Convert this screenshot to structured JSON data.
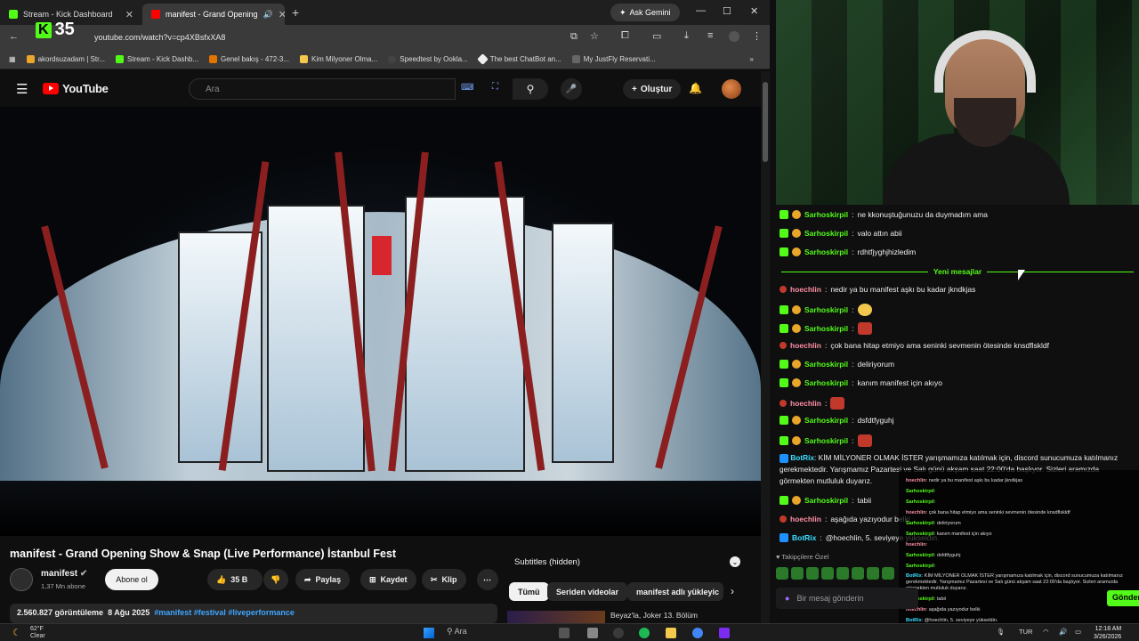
{
  "browser": {
    "tabs": [
      {
        "label": "Stream - Kick Dashboard",
        "active": false,
        "favicon_color": "#53fc18"
      },
      {
        "label": "manifest - Grand Opening",
        "active": true,
        "favicon_color": "#ff0000"
      }
    ],
    "new_tab_icon": "plus-icon",
    "gemini_label": "Ask Gemini",
    "url": "youtube.com/watch?v=cp4XBsfxXA8",
    "kick_badge_number": "35",
    "bookmarks": [
      "akordsuzadam | Str...",
      "Stream - Kick Dashb...",
      "Genel bakış - 472-3...",
      "Kim Milyoner Olma...",
      "Speedtest by Ookla...",
      "The best ChatBot an...",
      "My JustFly Reservati..."
    ]
  },
  "youtube": {
    "logo_text": "YouTube",
    "search_placeholder": "Ara",
    "create_label": "Oluştur",
    "video": {
      "title": "manifest - Grand Opening Show & Snap (Live Performance) İstanbul Fest",
      "channel": "manifest",
      "subscribers": "1,37 Mn abone",
      "subscribe_label": "Abone ol",
      "likes": "35 B",
      "share_label": "Paylaş",
      "save_label": "Kaydet",
      "clip_label": "Klip",
      "views": "2.560.827 görüntüleme",
      "date": "8 Ağu 2025",
      "hashtags": "#manifest #festival #liveperformance"
    },
    "sidebar": {
      "subtitles_label": "Subtitles (hidden)",
      "chips": [
        "Tümü",
        "Seriden videolar",
        "manifest adlı yükleyic"
      ],
      "next_title": "Beyaz'la, Joker 13. Bölüm"
    }
  },
  "kick": {
    "new_messages_label": "Yeni mesajlar",
    "messages": [
      {
        "user": "Sarhoskirpil",
        "text": "ne kkonuştuğunuzu da duymadım ama",
        "type": "sub"
      },
      {
        "user": "Sarhoskirpil",
        "text": "valo attın abii",
        "type": "sub"
      },
      {
        "user": "Sarhoskirpil",
        "text": "rdhtfjyghjhizledim",
        "type": "sub"
      },
      {
        "user": "hoechlin",
        "text": "nedir ya bu manifest aşkı bu kadar jkndkjas",
        "type": "viewer"
      },
      {
        "user": "Sarhoskirpil",
        "text": "",
        "type": "sub",
        "emote": "yellow"
      },
      {
        "user": "Sarhoskirpil",
        "text": "",
        "type": "sub",
        "emote": "red"
      },
      {
        "user": "hoechlin",
        "text": "çok bana hitap etmiyo ama seninki sevmenin ötesinde knsdflskldf",
        "type": "viewer"
      },
      {
        "user": "Sarhoskirpil",
        "text": "deliriyorum",
        "type": "sub"
      },
      {
        "user": "Sarhoskirpil",
        "text": "kanım manifest için akıyo",
        "type": "sub"
      },
      {
        "user": "hoechlin",
        "text": "",
        "type": "viewer",
        "emote": "red"
      },
      {
        "user": "Sarhoskirpil",
        "text": "dsfdtfyguhj",
        "type": "sub"
      },
      {
        "user": "Sarhoskirpil",
        "text": "",
        "type": "sub",
        "emote": "red"
      }
    ],
    "bot_message": {
      "user": "BotRix",
      "text": "KİM MİLYONER OLMAK İSTER yarışmamıza katılmak için, discord sunucumuza katılmanız gerekmektedir. Yarışmamız Pazartesi ve Salı günü akşam saat 22:00'da başlıyor. Sizleri aramızda görmekten mutluluk duyarız."
    },
    "after_bot": [
      {
        "user": "Sarhoskirpil",
        "text": "tabii",
        "type": "sub"
      },
      {
        "user": "hoechlin",
        "text": "aşağıda yazıyodur belki",
        "type": "viewer"
      },
      {
        "user": "BotRix",
        "text": "@hoechlin, 5. seviyeye yükseldin.",
        "type": "bot"
      }
    ],
    "overlay_lines": [
      {
        "user": "hoechlin",
        "text": "nedir ya bu manifest aşkı bu kadar jkndkjas"
      },
      {
        "user": "Sarhoskirpil",
        "text": ""
      },
      {
        "user": "Sarhoskirpil",
        "text": ""
      },
      {
        "user": "hoechlin",
        "text": "çok bana hitap etmiyo ama seninki sevmenin ötesinde knsdflskldf"
      },
      {
        "user": "Sarhoskirpil",
        "text": "deliriyorum"
      },
      {
        "user": "Sarhoskirpil",
        "text": "kanım manifest için akıyo"
      },
      {
        "user": "hoechlin",
        "text": ""
      },
      {
        "user": "Sarhoskirpil",
        "text": "dsfdtfyguhj"
      },
      {
        "user": "Sarhoskirpil",
        "text": ""
      },
      {
        "user": "BotRix",
        "text": "KİM MİLYONER OLMAK İSTER yarışmamıza katılmak için, discord sunucumuza katılmanız gerekmektedir. Yarışmamız Pazartesi ve Salı günü akşam saat 22:00'da başlıyor. Sizleri aramızda görmekten mutluluk duyarız."
      },
      {
        "user": "Sarhoskirpil",
        "text": "tabii"
      },
      {
        "user": "hoechlin",
        "text": "aşağıda yazıyodur belki"
      },
      {
        "user": "BotRix",
        "text": "@hoechlin, 5. seviyeye yükseldin."
      }
    ],
    "pinned_label": "Takipçilere Özel",
    "input_placeholder": "Bir mesaj gönderin",
    "send_label": "Gönder"
  },
  "taskbar": {
    "temperature": "62°F",
    "weather": "Clear",
    "search_label": "Ara",
    "language": "TUR",
    "time": "12:18 AM",
    "date": "3/26/2026"
  }
}
